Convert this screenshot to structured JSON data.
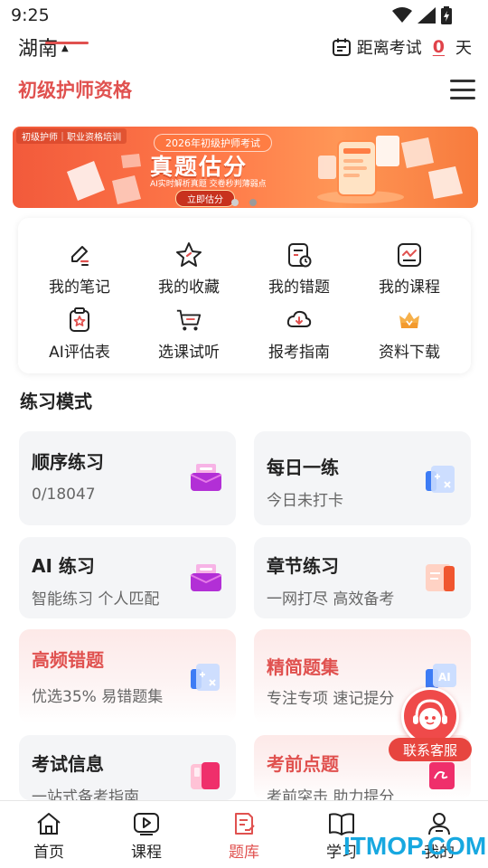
{
  "status_bar": {
    "time": "9:25"
  },
  "header": {
    "region": "湖南",
    "countdown_label": "距离考试",
    "countdown_days": "0",
    "countdown_unit": "天",
    "subject": "初级护师资格"
  },
  "banner": {
    "tag": "初级护师｜职业资格培训",
    "pill": "2026年初级护师考试",
    "headline": "真题估分",
    "sub": "AI实时解析真题 交卷秒判薄弱点",
    "cta": "立即估分"
  },
  "quick_links": [
    {
      "label": "我的笔记",
      "icon": "pencil-note-icon"
    },
    {
      "label": "我的收藏",
      "icon": "star-icon"
    },
    {
      "label": "我的错题",
      "icon": "wrong-question-icon"
    },
    {
      "label": "我的课程",
      "icon": "course-icon"
    },
    {
      "label": "AI评估表",
      "icon": "clipboard-star-icon"
    },
    {
      "label": "选课试听",
      "icon": "cart-icon"
    },
    {
      "label": "报考指南",
      "icon": "cloud-download-icon"
    },
    {
      "label": "资料下载",
      "icon": "crown-box-icon"
    }
  ],
  "section": {
    "title": "练习模式"
  },
  "practice": [
    {
      "title": "顺序练习",
      "sub": "0/18047",
      "icon": "inbox-icon"
    },
    {
      "title": "每日一练",
      "sub": "今日未打卡",
      "icon": "calculator-icon"
    },
    {
      "title": "AI 练习",
      "sub": "智能练习 个人匹配",
      "icon": "inbox-icon"
    },
    {
      "title": "章节练习",
      "sub": "一网打尽 高效备考",
      "icon": "book-stack-icon"
    },
    {
      "title": "高频错题",
      "sub": "优选35% 易错题集",
      "icon": "calculator-icon"
    },
    {
      "title": "精简题集",
      "sub": "专注专项 速记提分",
      "icon": "ai-card-icon"
    },
    {
      "title": "考试信息",
      "sub": "一站式备考指南",
      "icon": "card-stack-icon"
    },
    {
      "title": "考前点题",
      "sub": "考前突击 助力提分",
      "icon": "signature-card-icon"
    }
  ],
  "service": {
    "label": "联系客服"
  },
  "bottom_nav": [
    {
      "label": "首页",
      "icon": "home-icon"
    },
    {
      "label": "课程",
      "icon": "play-icon"
    },
    {
      "label": "题库",
      "icon": "question-bank-icon"
    },
    {
      "label": "学习",
      "icon": "book-icon"
    },
    {
      "label": "我的",
      "icon": "user-icon"
    }
  ],
  "watermark": "ITMOP.COM",
  "colors": {
    "accent": "#e0514f",
    "banner": "#f25a3b",
    "pink_card": "#fde9e8",
    "card": "#f4f5f7"
  }
}
